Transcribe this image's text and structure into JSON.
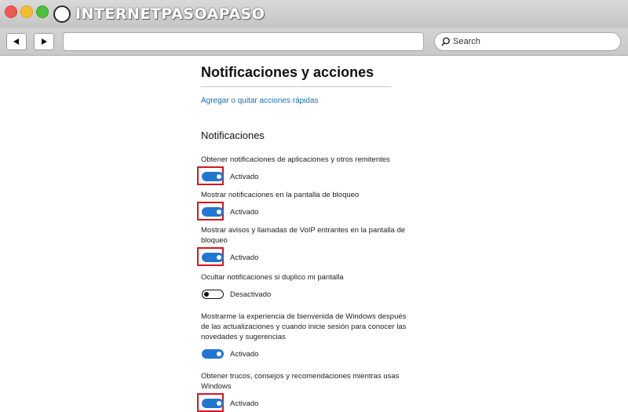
{
  "brand": {
    "text": "INTERNETPASOAPASO",
    "icon": "globe-icon"
  },
  "browser": {
    "back_icon": "triangle-left-icon",
    "forward_icon": "triangle-right-icon",
    "url_value": "",
    "search_placeholder": "Search"
  },
  "page": {
    "title": "Notificaciones y acciones",
    "quick_actions_link": "Agregar o quitar acciones rápidas",
    "section_title": "Notificaciones"
  },
  "settings": [
    {
      "label": "Obtener notificaciones de aplicaciones y otros remitentes",
      "state": "Activado",
      "on": true,
      "highlighted": true
    },
    {
      "label": "Mostrar notificaciones en la pantalla de bloqueo",
      "state": "Activado",
      "on": true,
      "highlighted": true
    },
    {
      "label": "Mostrar avisos y llamadas de VoIP entrantes en la pantalla de bloqueo",
      "state": "Activado",
      "on": true,
      "highlighted": true
    },
    {
      "label": "Ocultar notificaciones si duplico mi pantalla",
      "state": "Desactivado",
      "on": false,
      "highlighted": false
    },
    {
      "label": "Mostrarme la experiencia de bienvenida de Windows después de las actualizaciones y cuando inicie sesión para conocer las novedades y sugerencias",
      "state": "Activado",
      "on": true,
      "highlighted": false
    },
    {
      "label": "Obtener trucos, consejos y recomendaciones mientras usas Windows",
      "state": "Activado",
      "on": true,
      "highlighted": true
    }
  ],
  "colors": {
    "accent": "#2177cf",
    "highlight": "#d8161e",
    "link": "#1b6fb8"
  }
}
